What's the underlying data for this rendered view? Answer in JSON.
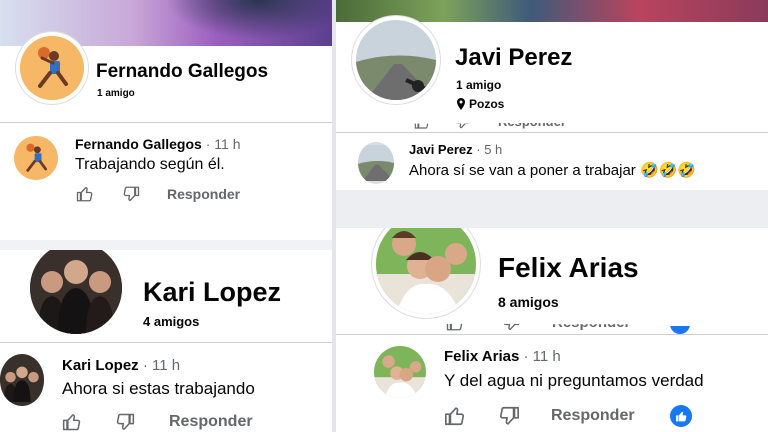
{
  "panels": {
    "fernando": {
      "profile_name": "Fernando Gallegos",
      "friends": "1 amigo",
      "comment": {
        "author": "Fernando Gallegos",
        "time": "11 h",
        "text": "Trabajando según él.",
        "reply_label": "Responder"
      }
    },
    "javi": {
      "profile_name": "Javi Perez",
      "friends": "1 amigo",
      "location": "Pozos",
      "cut_reply_label": "Responder",
      "comment": {
        "author": "Javi Perez",
        "time": "5 h",
        "text": "Ahora sí se van a poner a trabajar 🤣🤣🤣"
      }
    },
    "kari": {
      "profile_name": "Kari Lopez",
      "friends": "4 amigos",
      "comment": {
        "author": "Kari Lopez",
        "time": "11 h",
        "text": "Ahora si estas trabajando",
        "reply_label": "Responder"
      }
    },
    "felix": {
      "profile_name": "Felix Arias",
      "friends": "8 amigos",
      "cut_reply_label": "Responder",
      "comment": {
        "author": "Felix Arias",
        "time": "11 h",
        "text": "Y del agua ni preguntamos verdad",
        "reply_label": "Responder"
      }
    }
  },
  "separator": "·",
  "colors": {
    "fb_blue": "#1877f2",
    "secondary_text": "#65676b",
    "divider": "#ced0d4"
  },
  "icons": [
    "like-icon",
    "dislike-icon",
    "location-pin-icon",
    "blue-like-reaction-icon"
  ]
}
